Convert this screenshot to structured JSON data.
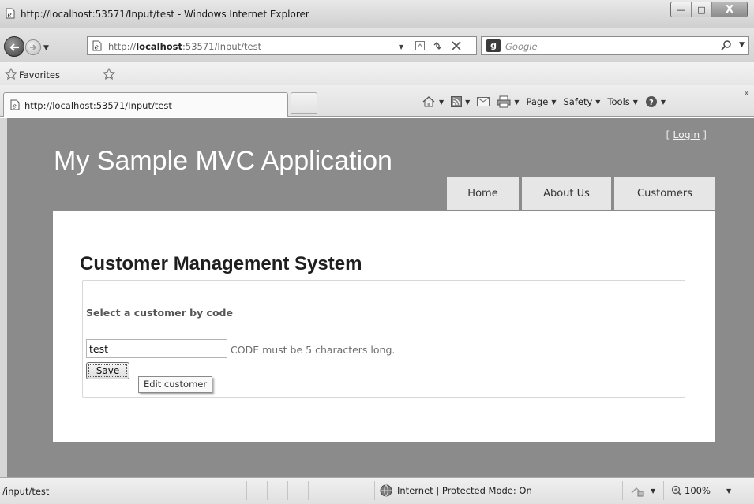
{
  "window": {
    "title": "http://localhost:53571/Input/test - Windows Internet Explorer",
    "min_glyph": "—",
    "max_glyph": "□",
    "close_glyph": "X"
  },
  "address": {
    "url_prefix": "http://",
    "url_host": "localhost",
    "url_rest": ":53571/Input/test",
    "search_placeholder": "Google"
  },
  "favorites": {
    "label": "Favorites"
  },
  "tabs": {
    "active_label": "http://localhost:53571/Input/test"
  },
  "command_bar": {
    "page_label": "Page",
    "safety_label": "Safety",
    "tools_label": "Tools",
    "overflow": "»"
  },
  "site": {
    "login_open": "[ ",
    "login_label": "Login",
    "login_close": " ]",
    "title": "My Sample MVC Application",
    "menu": [
      {
        "label": "Home"
      },
      {
        "label": "About Us"
      },
      {
        "label": "Customers"
      }
    ]
  },
  "form": {
    "heading": "Customer Management System",
    "legend": "Select a customer by code",
    "code_value": "test",
    "validation_message": "CODE must be 5 characters long.",
    "save_label": "Save",
    "tooltip": "Edit customer"
  },
  "status": {
    "url": "/input/test",
    "zone": "Internet | Protected Mode: On",
    "zoom": "100%"
  },
  "colors": {
    "page_background": "#8b8b8b",
    "menu_background": "#e6e6e6",
    "main_background": "#ffffff"
  },
  "icons": [
    "ie-page-icon",
    "back-icon",
    "forward-icon",
    "refresh-icon",
    "stop-icon",
    "search-icon",
    "favorites-star-icon",
    "add-favorites-icon",
    "home-icon",
    "feeds-icon",
    "mail-icon",
    "print-icon",
    "help-icon",
    "globe-icon",
    "zoom-icon"
  ]
}
